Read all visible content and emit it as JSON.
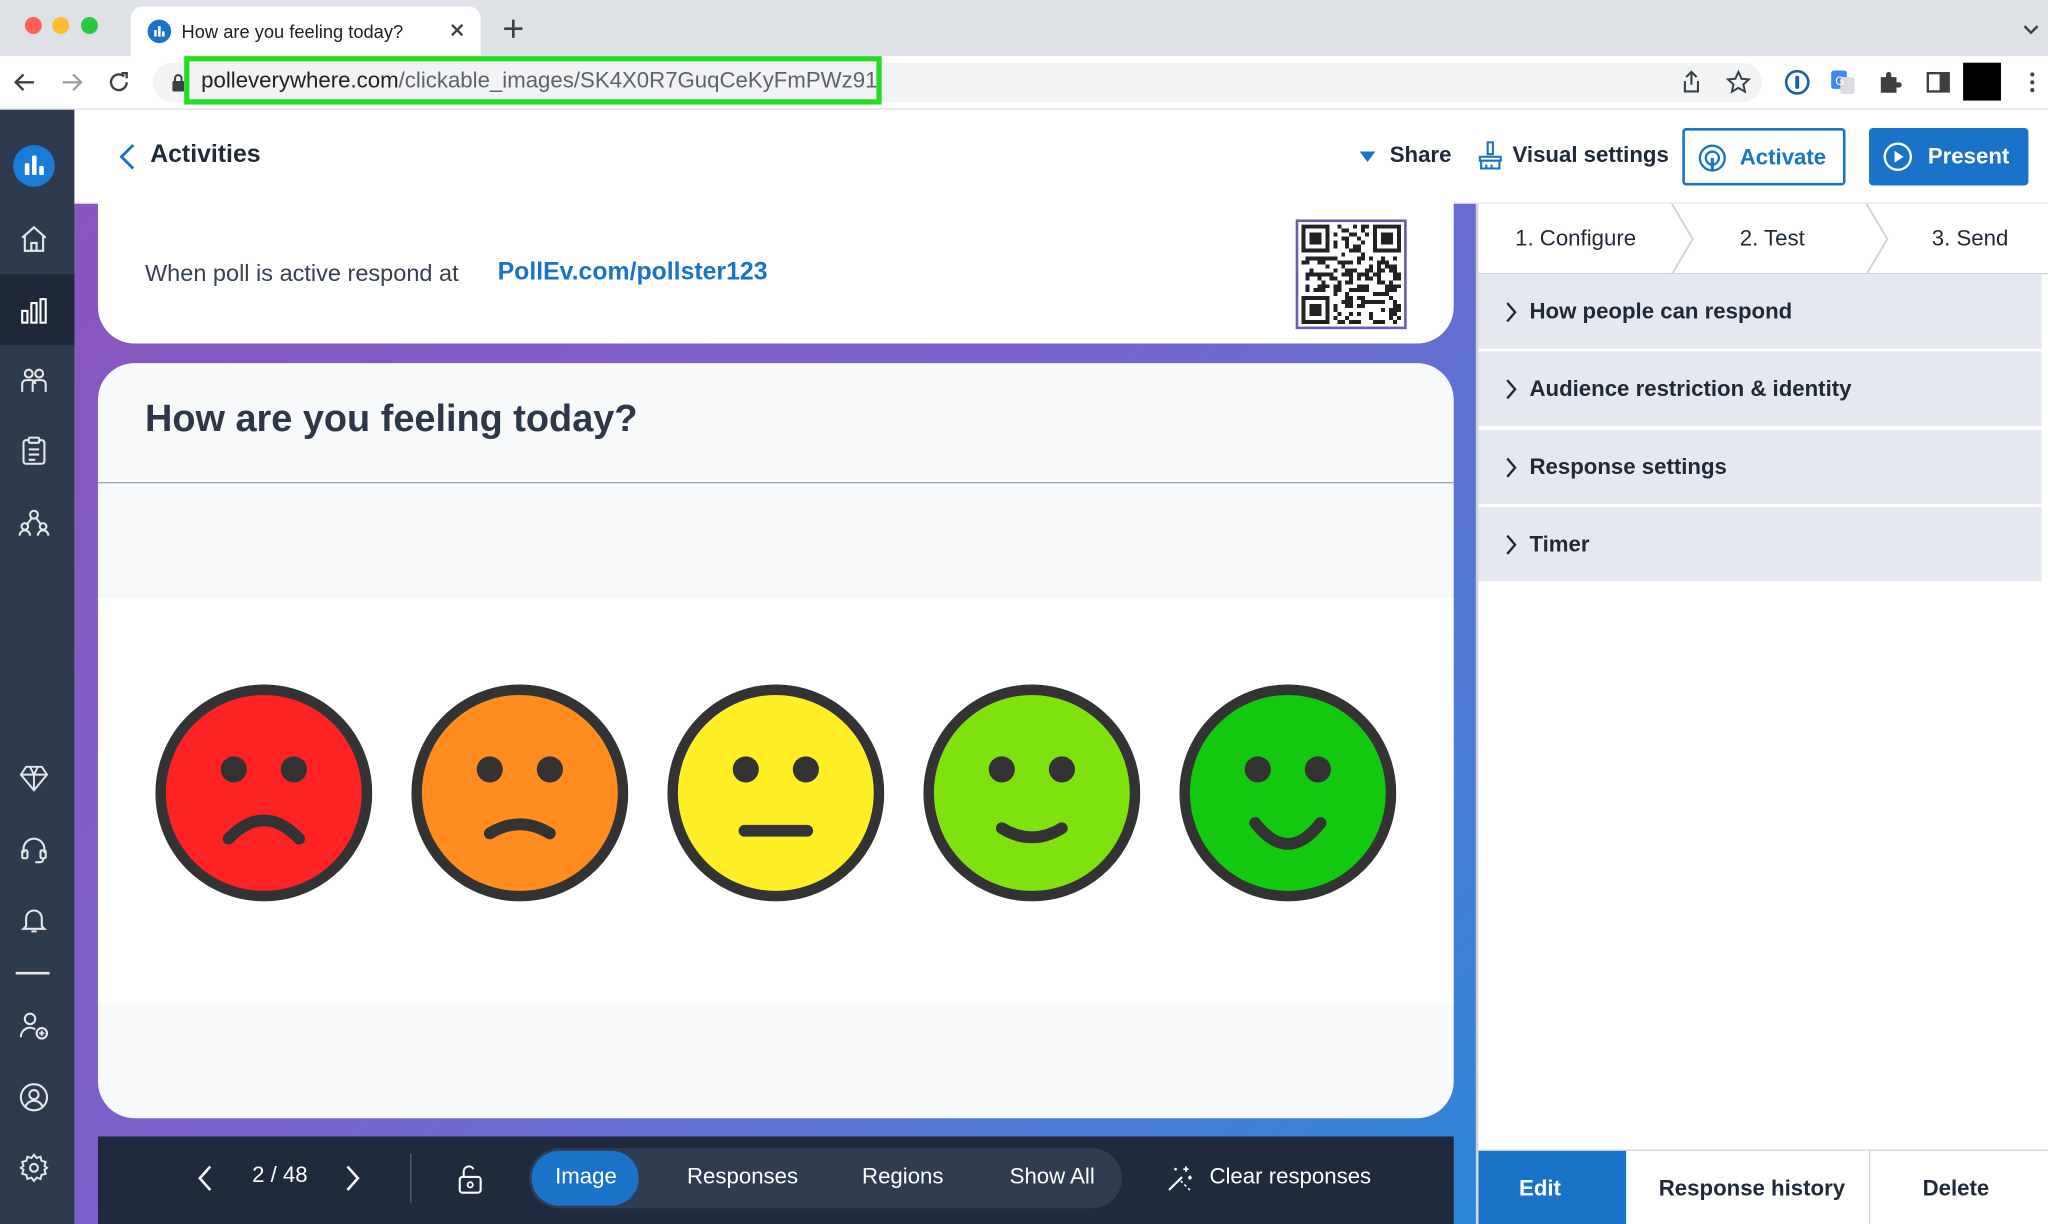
{
  "browser": {
    "tab_title": "How are you feeling today?",
    "url_domain": "polleverywhere.com",
    "url_path": "/clickable_images/SK4X0R7GuqCeKyFmPWz91"
  },
  "header": {
    "back_label": "Activities",
    "share_label": "Share",
    "visual_settings_label": "Visual settings",
    "activate_label": "Activate",
    "present_label": "Present"
  },
  "info_card": {
    "text": "When poll is active respond at",
    "link": "PollEv.com/pollster123"
  },
  "poll": {
    "question": "How are you feeling today?",
    "faces": [
      {
        "mood": "very-sad",
        "color": "#ff2222"
      },
      {
        "mood": "sad",
        "color": "#ff8c1f"
      },
      {
        "mood": "neutral",
        "color": "#ffef24"
      },
      {
        "mood": "happy",
        "color": "#7fe20f"
      },
      {
        "mood": "very-happy",
        "color": "#13c90f"
      }
    ]
  },
  "toolbar": {
    "pager": "2 / 48",
    "segments": [
      "Image",
      "Responses",
      "Regions",
      "Show All"
    ],
    "active_segment": "Image",
    "clear_label": "Clear responses"
  },
  "right_panel": {
    "steps": [
      "1. Configure",
      "2. Test",
      "3. Send"
    ],
    "accordion": [
      "How people can respond",
      "Audience restriction & identity",
      "Response settings",
      "Timer"
    ],
    "bottom_tabs": [
      "Edit",
      "Response history",
      "Delete"
    ],
    "active_bottom_tab": "Edit"
  },
  "colors": {
    "accent": "#1a73c8",
    "sidebar": "#2e3a4e",
    "toolbar": "#1f2a3c",
    "highlight_box": "#22dd22"
  },
  "icons": {
    "sidebar": [
      "home-icon",
      "activities-icon",
      "participants-icon",
      "clipboard-icon",
      "groups-icon",
      "upgrade-diamond-icon",
      "support-headset-icon",
      "notifications-bell-icon",
      "add-user-icon",
      "profile-icon",
      "settings-gear-icon"
    ]
  }
}
